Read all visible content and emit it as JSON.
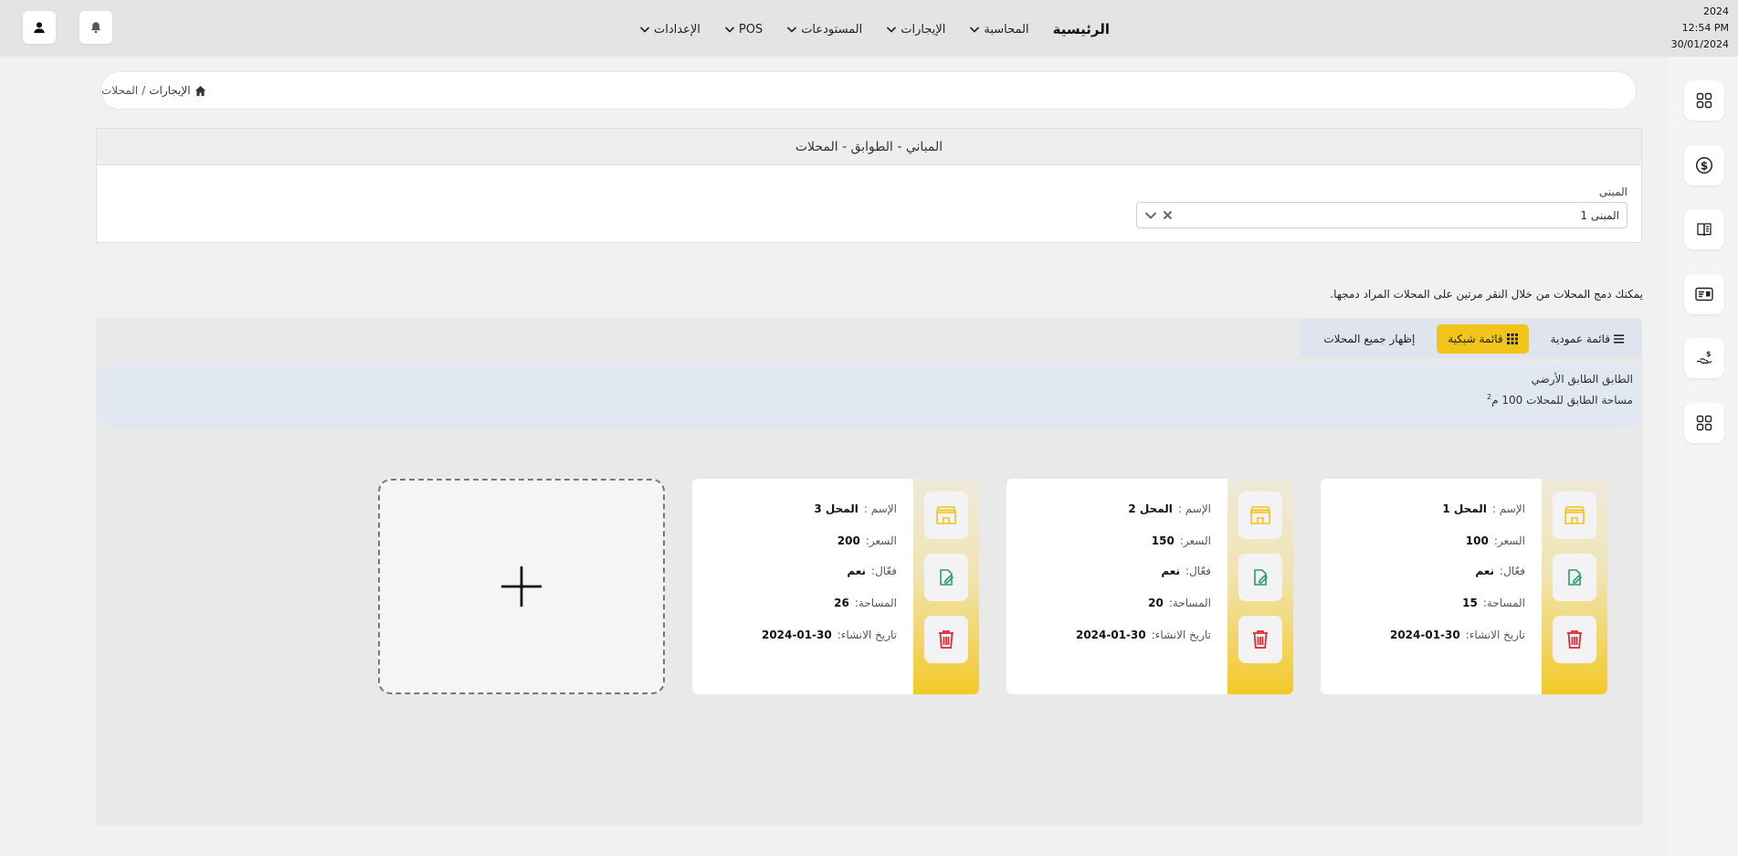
{
  "header": {
    "datetime": {
      "year": "2024",
      "time": "12:54 PM",
      "date": "30/01/2024"
    },
    "nav": {
      "home": "الرئيسية",
      "accounting": "المحاسبة",
      "rentals": "الإيجارات",
      "warehouses": "المستودعات",
      "pos": "POS",
      "settings": "الإعدادات"
    },
    "icons": {
      "user": "user-icon",
      "bell": "bell-icon"
    }
  },
  "breadcrumb": {
    "parent": "الإيجارات",
    "separator": "/",
    "current": "المحلات"
  },
  "panel": {
    "title": "المباني - الطوابق - المحلات",
    "building_label": "المبنى",
    "building_value": "المبنى 1"
  },
  "hint": "يمكنك دمج المحلات من خلال النقر مرتين على المحلات المراد دمجها.",
  "view_toggle": {
    "list_label": "قائمة عمودية",
    "grid_label": "قائمة شبكية",
    "show_all_label": "إظهار جميع المحلات",
    "active": "grid"
  },
  "floor": {
    "title": "الطابق الطابق الأرضي",
    "area_text": "مساحة الطابق للمحلات 100 م",
    "area_sup": "2"
  },
  "labels": {
    "name": "الإسم :",
    "price": "السعر:",
    "active": "فعّال:",
    "area": "المساحة:",
    "created": "تاريخ الانشاء:"
  },
  "shops": [
    {
      "name": "المحل 1",
      "price": "100",
      "active": "نعم",
      "area": "15",
      "created": "2024-01-30"
    },
    {
      "name": "المحل 2",
      "price": "150",
      "active": "نعم",
      "area": "20",
      "created": "2024-01-30"
    },
    {
      "name": "المحل 3",
      "price": "200",
      "active": "نعم",
      "area": "26",
      "created": "2024-01-30"
    }
  ],
  "colors": {
    "accent": "#f2c318",
    "delete": "#e0262d",
    "edit": "#2e9d6a",
    "shop": "#f2c318"
  }
}
